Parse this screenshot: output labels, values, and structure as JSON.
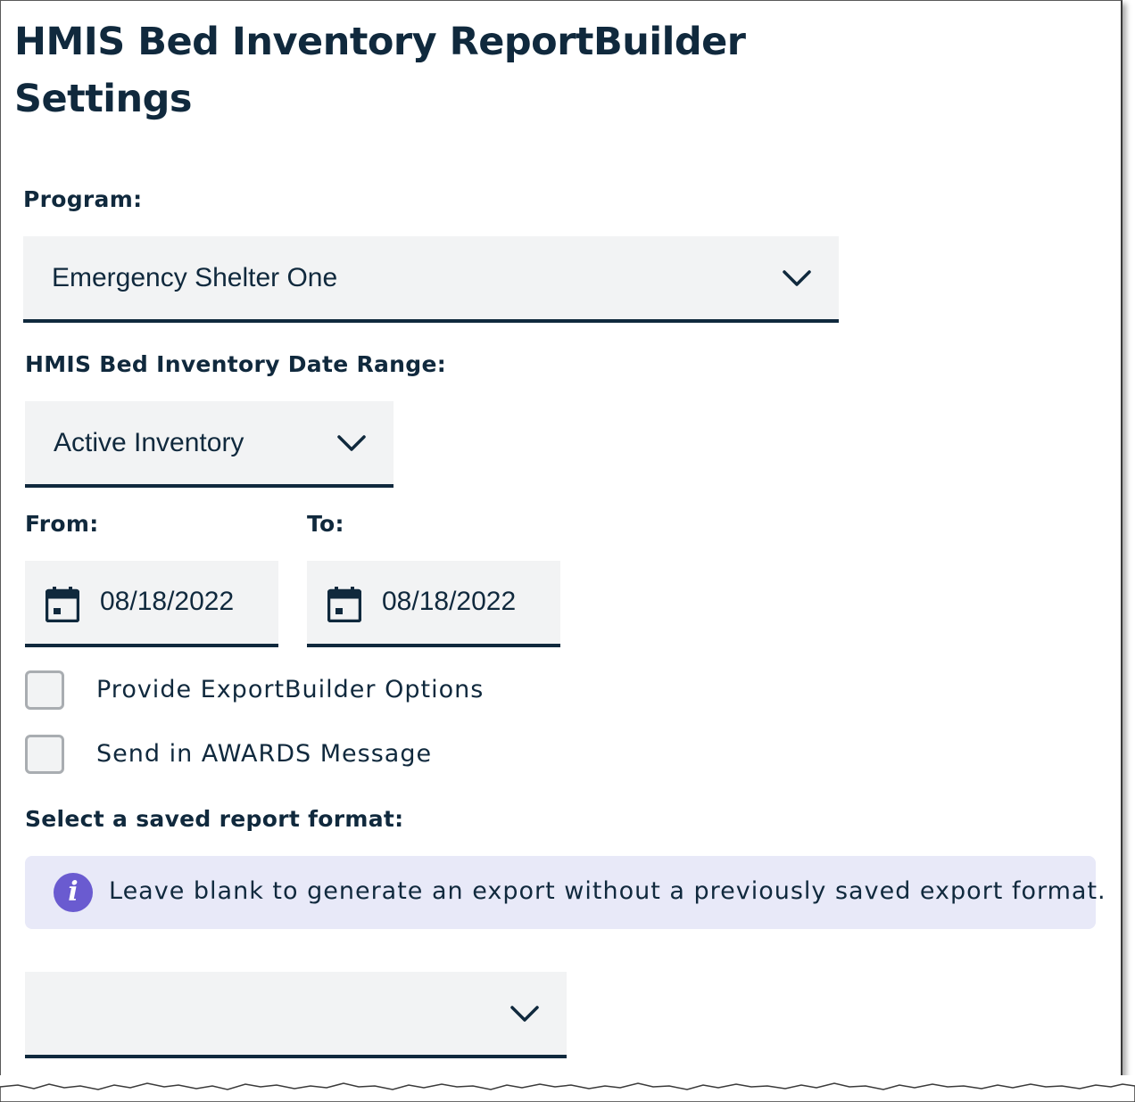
{
  "page": {
    "title_line1": "HMIS Bed Inventory ReportBuilder",
    "title_line2": "Settings"
  },
  "program": {
    "label": "Program:",
    "selected": "Emergency Shelter One"
  },
  "date_range": {
    "label": "HMIS Bed Inventory Date Range:",
    "selected": "Active Inventory"
  },
  "from": {
    "label": "From:",
    "value": "08/18/2022"
  },
  "to": {
    "label": "To:",
    "value": "08/18/2022"
  },
  "options": [
    {
      "label": "Provide ExportBuilder Options",
      "checked": false
    },
    {
      "label": "Send in AWARDS Message",
      "checked": false
    }
  ],
  "report_format": {
    "label": "Select a saved report format:",
    "info_text": "Leave blank to generate an export without a previously saved export format.",
    "selected": ""
  },
  "icons": {
    "dropdown": "chevron-down-icon",
    "date": "calendar-icon",
    "info": "info-icon"
  },
  "colors": {
    "text": "#10293d",
    "field_bg": "#f2f3f4",
    "info_bg": "#e8e9f8",
    "info_icon": "#6a5bd0"
  }
}
